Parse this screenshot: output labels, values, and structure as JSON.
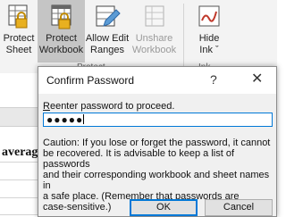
{
  "ribbon": {
    "buttons": [
      {
        "line1": "Protect",
        "line2": "Sheet"
      },
      {
        "line1": "Protect",
        "line2": "Workbook"
      },
      {
        "line1": "Allow Edit",
        "line2": "Ranges"
      },
      {
        "line1": "Unshare",
        "line2": "Workbook"
      },
      {
        "line1": "Hide",
        "line2": "Ink ˇ"
      }
    ],
    "groups": {
      "protect": "Protect",
      "ink": "Ink"
    }
  },
  "sheet": {
    "cell_text": "averag"
  },
  "dialog": {
    "title": "Confirm Password",
    "help": "?",
    "close": "✕",
    "prompt_accel": "R",
    "prompt_rest": "eenter password to proceed.",
    "password_mask": "●●●●●",
    "caution_lines": [
      "Caution: If you lose or forget the password, it cannot",
      "be recovered. It is advisable to keep a list of passwords",
      "and their corresponding workbook and sheet names in",
      "a safe place.  (Remember that passwords are",
      "case-sensitive.)"
    ],
    "ok_label": "OK",
    "cancel_label": "Cancel"
  }
}
